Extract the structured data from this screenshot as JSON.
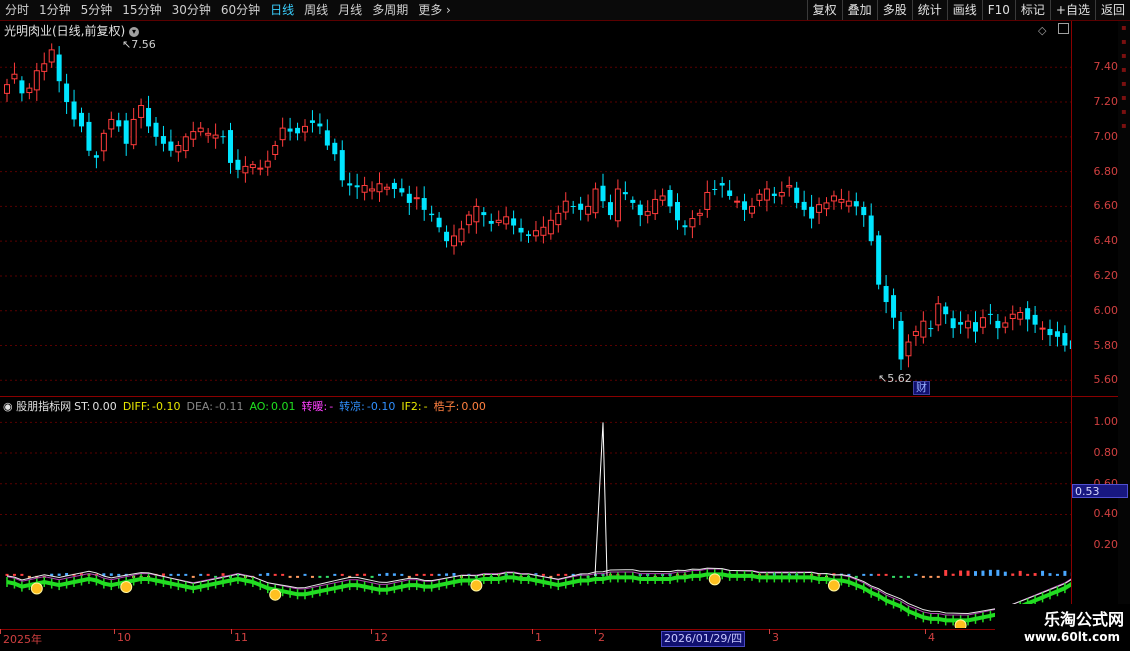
{
  "toolbar": {
    "periods": [
      "分时",
      "1分钟",
      "5分钟",
      "15分钟",
      "30分钟",
      "60分钟",
      "日线",
      "周线",
      "月线",
      "多周期",
      "更多"
    ],
    "active": "日线",
    "more_icon": "chevron-right-icon",
    "tools": [
      "复权",
      "叠加",
      "多股",
      "统计",
      "画线",
      "F10",
      "标记",
      "+自选",
      "返回"
    ]
  },
  "kline": {
    "title": "光明肉业(日线,前复权)",
    "y_ticks": [
      "7.40",
      "7.20",
      "7.00",
      "6.80",
      "6.60",
      "6.40",
      "6.20",
      "6.00",
      "5.80",
      "5.60"
    ],
    "high_label": "7.56",
    "low_label": "5.62",
    "finance_tag": "财"
  },
  "indicator": {
    "name": "股朋指标网",
    "fields": [
      {
        "label": "ST:",
        "value": "0.00",
        "color": "#e0e0e0"
      },
      {
        "label": "DIFF:",
        "value": "-0.10",
        "color": "#e8e800"
      },
      {
        "label": "DEA:",
        "value": "-0.11",
        "color": "#888888"
      },
      {
        "label": "AO:",
        "value": "0.01",
        "color": "#20e020"
      },
      {
        "label": "转暖:",
        "value": "-",
        "color": "#ff40ff"
      },
      {
        "label": "转凉:",
        "value": "-0.10",
        "color": "#3090ff"
      },
      {
        "label": "IF2:",
        "value": "-",
        "color": "#e8e800"
      },
      {
        "label": "梏子:",
        "value": "0.00",
        "color": "#ff8040"
      }
    ],
    "y_ticks": [
      "1.00",
      "0.80",
      "0.60",
      "0.40",
      "0.20"
    ],
    "current_value": "0.53"
  },
  "xaxis": {
    "labels": [
      "2025年",
      "10",
      "11",
      "12",
      "1",
      "2",
      "3",
      "4"
    ],
    "cursor_date": "2026/01/29/四"
  },
  "watermark": {
    "line1": "乐淘公式网",
    "line2": "www.60lt.com"
  },
  "colors": {
    "up": "#ff3c3c",
    "down": "#00e5ff",
    "grid": "#8a0000",
    "ao": "#22dd22"
  },
  "chart_data": {
    "type": "candlestick",
    "title": "光明肉业(日线,前复权)",
    "ylim": [
      5.55,
      7.62
    ],
    "y_ticks": [
      7.4,
      7.2,
      7.0,
      6.8,
      6.6,
      6.4,
      6.2,
      6.0,
      5.8,
      5.6
    ],
    "high": 7.56,
    "low": 5.62,
    "closes": [
      7.3,
      7.36,
      7.25,
      7.28,
      7.38,
      7.42,
      7.5,
      7.32,
      7.2,
      7.1,
      7.06,
      6.92,
      6.88,
      7.02,
      7.1,
      7.06,
      6.96,
      7.1,
      7.18,
      7.06,
      7.0,
      6.96,
      6.92,
      6.95,
      7.0,
      7.03,
      7.05,
      7.02,
      7.01,
      7.0,
      6.85,
      6.81,
      6.83,
      6.84,
      6.82,
      6.86,
      6.95,
      7.05,
      7.03,
      7.02,
      7.06,
      7.08,
      7.06,
      6.95,
      6.9,
      6.75,
      6.72,
      6.71,
      6.72,
      6.7,
      6.73,
      6.71,
      6.7,
      6.68,
      6.62,
      6.65,
      6.58,
      6.55,
      6.48,
      6.4,
      6.43,
      6.47,
      6.55,
      6.6,
      6.55,
      6.5,
      6.52,
      6.54,
      6.49,
      6.45,
      6.43,
      6.46,
      6.48,
      6.52,
      6.56,
      6.63,
      6.6,
      6.58,
      6.6,
      6.7,
      6.63,
      6.55,
      6.7,
      6.67,
      6.62,
      6.55,
      6.57,
      6.64,
      6.66,
      6.6,
      6.52,
      6.48,
      6.53,
      6.56,
      6.68,
      6.7,
      6.72,
      6.66,
      6.63,
      6.58,
      6.6,
      6.67,
      6.7,
      6.66,
      6.68,
      6.72,
      6.62,
      6.58,
      6.53,
      6.61,
      6.62,
      6.66,
      6.64,
      6.63,
      6.6,
      6.55,
      6.4,
      6.15,
      6.05,
      5.96,
      5.72,
      5.82,
      5.88,
      5.94,
      5.9,
      6.04,
      5.98,
      5.9,
      5.92,
      5.94,
      5.88,
      5.96,
      5.98,
      5.9,
      5.93,
      5.98,
      5.99,
      5.95,
      5.92,
      5.9,
      5.86,
      5.85,
      5.8,
      5.78
    ],
    "ao_values": [
      -0.04,
      -0.05,
      -0.07,
      -0.06,
      -0.05,
      -0.04,
      -0.05,
      -0.06,
      -0.05,
      -0.04,
      -0.03,
      -0.02,
      -0.03,
      -0.05,
      -0.06,
      -0.05,
      -0.04,
      -0.03,
      -0.02,
      -0.02,
      -0.03,
      -0.04,
      -0.05,
      -0.06,
      -0.07,
      -0.08,
      -0.07,
      -0.06,
      -0.05,
      -0.04,
      -0.03,
      -0.02,
      -0.03,
      -0.04,
      -0.06,
      -0.08,
      -0.09,
      -0.1,
      -0.11,
      -0.12,
      -0.12,
      -0.11,
      -0.1,
      -0.09,
      -0.08,
      -0.07,
      -0.06,
      -0.06,
      -0.07,
      -0.08,
      -0.09,
      -0.09,
      -0.08,
      -0.07,
      -0.06,
      -0.06,
      -0.07,
      -0.07,
      -0.06,
      -0.05,
      -0.04,
      -0.03,
      -0.03,
      -0.03,
      -0.02,
      -0.02,
      -0.02,
      -0.01,
      -0.01,
      -0.02,
      -0.02,
      -0.03,
      -0.04,
      -0.05,
      -0.06,
      -0.05,
      -0.04,
      -0.03,
      -0.03,
      -0.02,
      -0.02,
      -0.01,
      -0.01,
      -0.01,
      -0.01,
      -0.02,
      -0.02,
      -0.02,
      -0.02,
      -0.02,
      -0.01,
      -0.01,
      -0.0,
      0.0,
      0.01,
      0.01,
      0.01,
      0.0,
      0.0,
      0.0,
      -0.0,
      -0.01,
      -0.01,
      -0.01,
      -0.01,
      -0.01,
      -0.01,
      -0.01,
      -0.01,
      -0.02,
      -0.02,
      -0.03,
      -0.03,
      -0.04,
      -0.06,
      -0.08,
      -0.11,
      -0.13,
      -0.16,
      -0.18,
      -0.2,
      -0.23,
      -0.25,
      -0.27,
      -0.28,
      -0.28,
      -0.29,
      -0.29,
      -0.29,
      -0.29,
      -0.28,
      -0.27,
      -0.26,
      -0.25,
      -0.24,
      -0.22,
      -0.2,
      -0.18,
      -0.16,
      -0.14,
      -0.12,
      -0.1,
      -0.08,
      -0.05
    ],
    "st_spike_value": 1.0,
    "ind_ylim": [
      -0.32,
      1.1
    ]
  }
}
